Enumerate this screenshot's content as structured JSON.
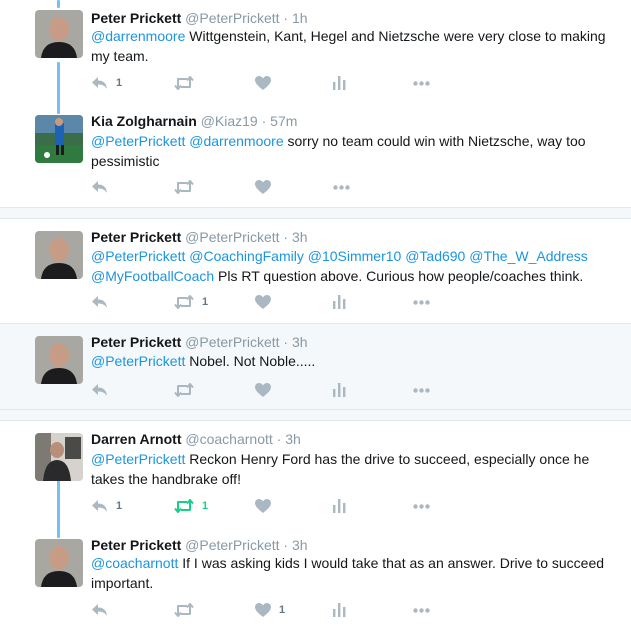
{
  "tweets": [
    {
      "name": "Peter Prickett",
      "handle": "@PeterPrickett",
      "time": "· 1h",
      "text_parts": [
        {
          "t": "@darrenmoore",
          "m": true
        },
        {
          "t": " Wittgenstein, Kant, Hegel and Nietzsche were very close to making my team.",
          "m": false
        }
      ],
      "reply_count": "1",
      "retweet_count": "",
      "like_count": ""
    },
    {
      "name": "Kia Zolgharnain",
      "handle": "@Kiaz19",
      "time": "· 57m",
      "text_parts": [
        {
          "t": "@PeterPrickett",
          "m": true
        },
        {
          "t": " ",
          "m": false
        },
        {
          "t": "@darrenmoore",
          "m": true
        },
        {
          "t": " sorry no team could win with Nietzsche, way too pessimistic",
          "m": false
        }
      ],
      "reply_count": "",
      "retweet_count": "",
      "like_count": ""
    },
    {
      "name": "Peter Prickett",
      "handle": "@PeterPrickett",
      "time": "· 3h",
      "text_parts": [
        {
          "t": "@PeterPrickett",
          "m": true
        },
        {
          "t": " ",
          "m": false
        },
        {
          "t": "@CoachingFamily",
          "m": true
        },
        {
          "t": " ",
          "m": false
        },
        {
          "t": "@10Simmer10",
          "m": true
        },
        {
          "t": " ",
          "m": false
        },
        {
          "t": "@Tad690",
          "m": true
        },
        {
          "t": " ",
          "m": false
        },
        {
          "t": "@The_W_Address",
          "m": true
        },
        {
          "t": " ",
          "m": false
        },
        {
          "t": "@MyFootballCoach",
          "m": true
        },
        {
          "t": " Pls RT question above. Curious how people/coaches think.",
          "m": false
        }
      ],
      "reply_count": "",
      "retweet_count": "1",
      "like_count": ""
    },
    {
      "name": "Peter Prickett",
      "handle": "@PeterPrickett",
      "time": "· 3h",
      "text_parts": [
        {
          "t": "@PeterPrickett",
          "m": true
        },
        {
          "t": " Nobel. Not Noble.....",
          "m": false
        }
      ],
      "reply_count": "",
      "retweet_count": "",
      "like_count": ""
    },
    {
      "name": "Darren Arnott",
      "handle": "@coacharnott",
      "time": "· 3h",
      "text_parts": [
        {
          "t": "@PeterPrickett",
          "m": true
        },
        {
          "t": " Reckon Henry Ford has the drive to succeed, especially once he takes the handbrake off!",
          "m": false
        }
      ],
      "reply_count": "1",
      "retweet_count": "1",
      "like_count": ""
    },
    {
      "name": "Peter Prickett",
      "handle": "@PeterPrickett",
      "time": "· 3h",
      "text_parts": [
        {
          "t": "@coacharnott",
          "m": true
        },
        {
          "t": " If I was asking kids I would take that as an answer. Drive to succeed important.",
          "m": false
        }
      ],
      "reply_count": "",
      "retweet_count": "",
      "like_count": "1"
    }
  ],
  "icons": {
    "reply": "reply-icon",
    "retweet": "retweet-icon",
    "like": "heart-icon",
    "analytics": "analytics-icon",
    "more": "more-icon"
  },
  "colors": {
    "mention": "#1b95e0",
    "icon": "#aab8c2",
    "retweeted": "#19cf86",
    "thread_line": "#73c2ef",
    "highlight_bg": "#f5f8fa"
  }
}
